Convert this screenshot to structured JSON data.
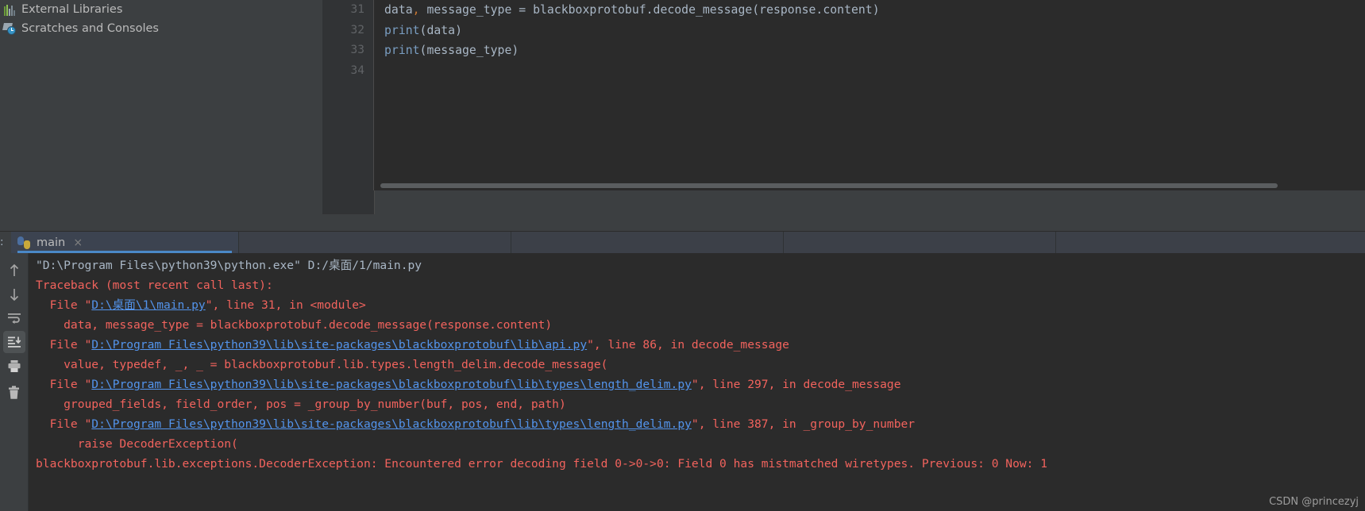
{
  "project_tree": {
    "items": [
      {
        "icon": "external-libraries-icon",
        "label": "External Libraries"
      },
      {
        "icon": "scratches-and-consoles-icon",
        "label": "Scratches and Consoles"
      }
    ]
  },
  "editor": {
    "line_numbers": [
      "31",
      "32",
      "33",
      "34"
    ],
    "lines": [
      {
        "pre": "data",
        "comma": ",",
        "post": " message_type = blackboxprotobuf.decode_message(response.content)",
        "kind": "assignment"
      },
      {
        "fn": "print",
        "args": "(data)",
        "kind": "call"
      },
      {
        "fn": "print",
        "args": "(message_type)",
        "kind": "call"
      },
      {
        "pre": "",
        "comma": "",
        "post": "",
        "kind": "blank"
      }
    ],
    "scrollbar": {
      "orientation": "horizontal"
    }
  },
  "run_panel": {
    "prefix_label": ":",
    "tab": {
      "icon": "python-file-icon",
      "name": "main",
      "close_label": "×"
    },
    "toolbar": [
      {
        "name": "rerun-failed-tests-up-icon",
        "icon": "arrow-up",
        "selected": false
      },
      {
        "name": "next-occurrence-down-icon",
        "icon": "arrow-down",
        "selected": false
      },
      {
        "name": "soft-wrap-icon",
        "icon": "soft-wrap",
        "selected": false
      },
      {
        "name": "scroll-to-end-icon",
        "icon": "scroll-to-end",
        "selected": true
      },
      {
        "name": "print-icon",
        "icon": "printer",
        "selected": false
      },
      {
        "name": "clear-all-icon",
        "icon": "trash",
        "selected": false
      }
    ],
    "output": [
      {
        "type": "command",
        "segments": [
          {
            "text": "\"D:\\Program Files\\python39\\python.exe\" D:/桌面/1/main.py",
            "style": "cmd"
          }
        ]
      },
      {
        "type": "error",
        "segments": [
          {
            "text": "Traceback (most recent call last):",
            "style": "err"
          }
        ]
      },
      {
        "type": "error",
        "segments": [
          {
            "text": "  File \"",
            "style": "err"
          },
          {
            "text": "D:\\桌面\\1\\main.py",
            "style": "link"
          },
          {
            "text": "\", line 31, in <module>",
            "style": "err"
          }
        ]
      },
      {
        "type": "error",
        "segments": [
          {
            "text": "    data, message_type = blackboxprotobuf.decode_message(response.content)",
            "style": "err"
          }
        ]
      },
      {
        "type": "error",
        "segments": [
          {
            "text": "  File \"",
            "style": "err"
          },
          {
            "text": "D:\\Program Files\\python39\\lib\\site-packages\\blackboxprotobuf\\lib\\api.py",
            "style": "link"
          },
          {
            "text": "\", line 86, in decode_message",
            "style": "err"
          }
        ]
      },
      {
        "type": "error",
        "segments": [
          {
            "text": "    value, typedef, _, _ = blackboxprotobuf.lib.types.length_delim.decode_message(",
            "style": "err"
          }
        ]
      },
      {
        "type": "error",
        "segments": [
          {
            "text": "  File \"",
            "style": "err"
          },
          {
            "text": "D:\\Program Files\\python39\\lib\\site-packages\\blackboxprotobuf\\lib\\types\\length_delim.py",
            "style": "link"
          },
          {
            "text": "\", line 297, in decode_message",
            "style": "err"
          }
        ]
      },
      {
        "type": "error",
        "segments": [
          {
            "text": "    grouped_fields, field_order, pos = _group_by_number(buf, pos, end, path)",
            "style": "err"
          }
        ]
      },
      {
        "type": "error",
        "segments": [
          {
            "text": "  File \"",
            "style": "err"
          },
          {
            "text": "D:\\Program Files\\python39\\lib\\site-packages\\blackboxprotobuf\\lib\\types\\length_delim.py",
            "style": "link"
          },
          {
            "text": "\", line 387, in _group_by_number",
            "style": "err"
          }
        ]
      },
      {
        "type": "error",
        "segments": [
          {
            "text": "      raise DecoderException(",
            "style": "err"
          }
        ]
      },
      {
        "type": "error",
        "segments": [
          {
            "text": "blackboxprotobuf.lib.exceptions.DecoderException: Encountered error decoding field 0->0->0: Field 0 has mistmatched wiretypes. Previous: 0 Now: 1",
            "style": "err"
          }
        ]
      }
    ]
  },
  "watermark": {
    "text": "CSDN @princezyj"
  },
  "colors": {
    "editor_bg": "#2b2b2b",
    "panel_bg": "#3c3f41",
    "gutter_bg": "#313335",
    "text": "#a9b7c6",
    "error": "#f2635d",
    "link": "#5394ec",
    "accent": "#4a88c7"
  }
}
